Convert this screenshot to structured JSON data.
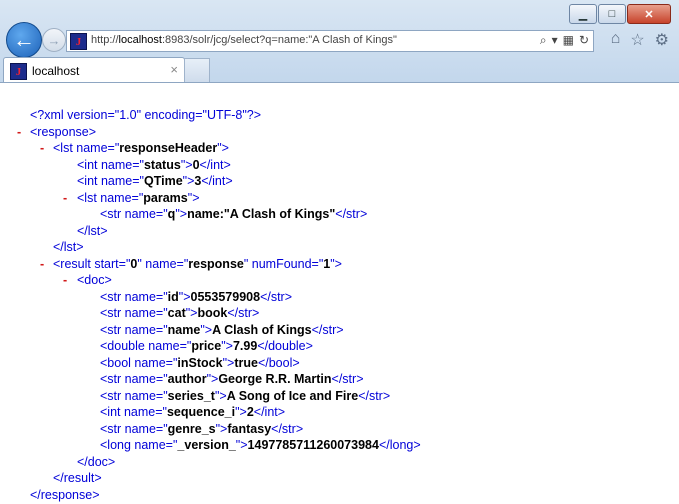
{
  "window": {
    "min_symbol": "▁",
    "max_symbol": "□",
    "close_symbol": "✕"
  },
  "address_bar": {
    "url_prefix": "http://",
    "url_host": "localhost",
    "url_rest": ":8983/solr/jcg/select?q=name:\"A Clash of Kings\""
  },
  "tab": {
    "label": "localhost",
    "close": "×"
  },
  "icons": {
    "back": "back-arrow-icon",
    "forward": "forward-arrow-icon",
    "home": "home-icon",
    "favorites": "star-icon",
    "settings": "gear-icon"
  },
  "xml": [
    {
      "dash": "",
      "parts": [
        {
          "t": "<?xml version=\"1.0\" encoding=\"UTF-8\"?>"
        }
      ]
    },
    {
      "dash": "-",
      "parts": [
        {
          "t": "<response>"
        }
      ]
    },
    {
      "dash": "-",
      "parts": [
        {
          "t": "<lst name=\""
        },
        {
          "b": "responseHeader"
        },
        {
          "t": "\">"
        }
      ]
    },
    {
      "dash": "",
      "parts": [
        {
          "t": "<int name=\""
        },
        {
          "b": "status"
        },
        {
          "t": "\">"
        },
        {
          "b": "0"
        },
        {
          "t": "</int>"
        }
      ]
    },
    {
      "dash": "",
      "parts": [
        {
          "t": "<int name=\""
        },
        {
          "b": "QTime"
        },
        {
          "t": "\">"
        },
        {
          "b": "3"
        },
        {
          "t": "</int>"
        }
      ]
    },
    {
      "dash": "-",
      "parts": [
        {
          "t": "<lst name=\""
        },
        {
          "b": "params"
        },
        {
          "t": "\">"
        }
      ]
    },
    {
      "dash": "",
      "parts": [
        {
          "t": "<str name=\""
        },
        {
          "b": "q"
        },
        {
          "t": "\">"
        },
        {
          "b": "name:\"A Clash of Kings\""
        },
        {
          "t": "</str>"
        }
      ]
    },
    {
      "dash": "",
      "parts": [
        {
          "t": "</lst>"
        }
      ]
    },
    {
      "dash": "",
      "parts": [
        {
          "t": "</lst>"
        }
      ]
    },
    {
      "dash": "-",
      "parts": [
        {
          "t": "<result start=\""
        },
        {
          "b": "0"
        },
        {
          "t": "\" name=\""
        },
        {
          "b": "response"
        },
        {
          "t": "\" numFound=\""
        },
        {
          "b": "1"
        },
        {
          "t": "\">"
        }
      ]
    },
    {
      "dash": "-",
      "parts": [
        {
          "t": "<doc>"
        }
      ]
    },
    {
      "dash": "",
      "parts": [
        {
          "t": "<str name=\""
        },
        {
          "b": "id"
        },
        {
          "t": "\">"
        },
        {
          "b": "0553579908"
        },
        {
          "t": "</str>"
        }
      ]
    },
    {
      "dash": "",
      "parts": [
        {
          "t": "<str name=\""
        },
        {
          "b": "cat"
        },
        {
          "t": "\">"
        },
        {
          "b": "book"
        },
        {
          "t": "</str>"
        }
      ]
    },
    {
      "dash": "",
      "parts": [
        {
          "t": "<str name=\""
        },
        {
          "b": "name"
        },
        {
          "t": "\">"
        },
        {
          "b": "A Clash of Kings"
        },
        {
          "t": "</str>"
        }
      ]
    },
    {
      "dash": "",
      "parts": [
        {
          "t": "<double name=\""
        },
        {
          "b": "price"
        },
        {
          "t": "\">"
        },
        {
          "b": "7.99"
        },
        {
          "t": "</double>"
        }
      ]
    },
    {
      "dash": "",
      "parts": [
        {
          "t": "<bool name=\""
        },
        {
          "b": "inStock"
        },
        {
          "t": "\">"
        },
        {
          "b": "true"
        },
        {
          "t": "</bool>"
        }
      ]
    },
    {
      "dash": "",
      "parts": [
        {
          "t": "<str name=\""
        },
        {
          "b": "author"
        },
        {
          "t": "\">"
        },
        {
          "b": "George R.R. Martin"
        },
        {
          "t": "</str>"
        }
      ]
    },
    {
      "dash": "",
      "parts": [
        {
          "t": "<str name=\""
        },
        {
          "b": "series_t"
        },
        {
          "t": "\">"
        },
        {
          "b": "A Song of Ice and Fire"
        },
        {
          "t": "</str>"
        }
      ]
    },
    {
      "dash": "",
      "parts": [
        {
          "t": "<int name=\""
        },
        {
          "b": "sequence_i"
        },
        {
          "t": "\">"
        },
        {
          "b": "2"
        },
        {
          "t": "</int>"
        }
      ]
    },
    {
      "dash": "",
      "parts": [
        {
          "t": "<str name=\""
        },
        {
          "b": "genre_s"
        },
        {
          "t": "\">"
        },
        {
          "b": "fantasy"
        },
        {
          "t": "</str>"
        }
      ]
    },
    {
      "dash": "",
      "parts": [
        {
          "t": "<long name=\""
        },
        {
          "b": "_version_"
        },
        {
          "t": "\">"
        },
        {
          "b": "1497785711260073984"
        },
        {
          "t": "</long>"
        }
      ]
    },
    {
      "dash": "",
      "parts": [
        {
          "t": "</doc>"
        }
      ]
    },
    {
      "dash": "",
      "parts": [
        {
          "t": "</result>"
        }
      ]
    },
    {
      "dash": "",
      "parts": [
        {
          "t": "</response>"
        }
      ]
    }
  ]
}
